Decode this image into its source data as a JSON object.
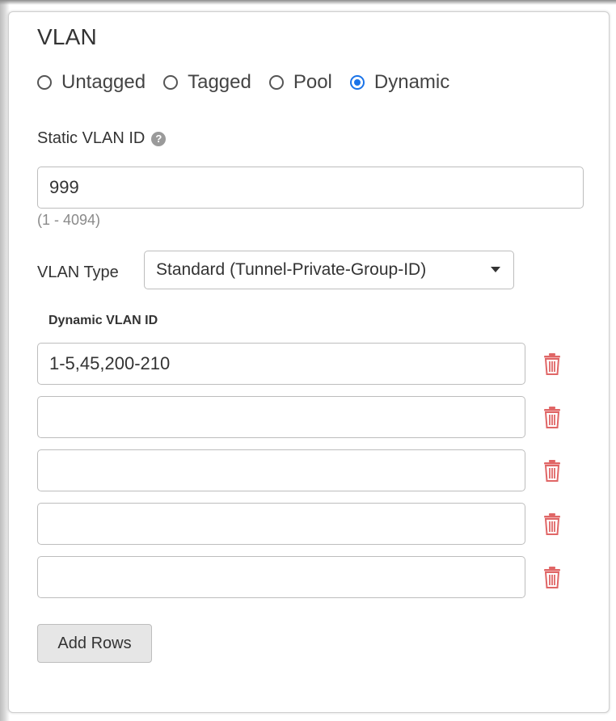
{
  "vlan": {
    "title": "VLAN",
    "mode_options": [
      {
        "label": "Untagged",
        "checked": false
      },
      {
        "label": "Tagged",
        "checked": false
      },
      {
        "label": "Pool",
        "checked": false
      },
      {
        "label": "Dynamic",
        "checked": true
      }
    ],
    "static_vlan_id": {
      "label": "Static VLAN ID",
      "help_icon": "question-mark",
      "value": "999",
      "hint": "(1 - 4094)"
    },
    "vlan_type": {
      "label": "VLAN Type",
      "selected": "Standard (Tunnel-Private-Group-ID)"
    },
    "dynamic_vlan": {
      "heading": "Dynamic VLAN ID",
      "rows": [
        "1-5,45,200-210",
        "",
        "",
        "",
        ""
      ],
      "delete_icon": "trash-icon",
      "delete_color": "#e06666"
    },
    "add_rows_label": "Add Rows"
  },
  "colors": {
    "radio_selected": "#1a73e8",
    "text": "#333333",
    "hint": "#8a8a8a"
  }
}
